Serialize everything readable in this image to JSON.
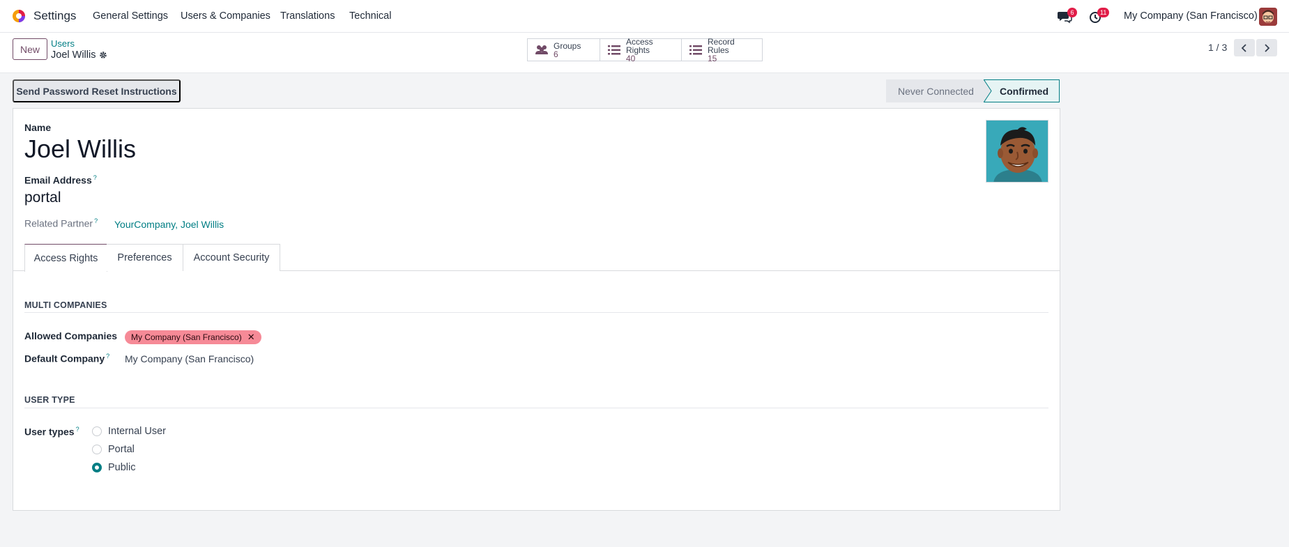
{
  "navbar": {
    "app_name": "Settings",
    "menu": [
      "General Settings",
      "Users & Companies",
      "Translations",
      "Technical"
    ],
    "messages_count": "6",
    "activities_count": "11",
    "company": "My Company (San Francisco)"
  },
  "control_panel": {
    "new_label": "New",
    "breadcrumb_parent": "Users",
    "breadcrumb_current": "Joel Willis",
    "smart_buttons": [
      {
        "label": "Groups",
        "value": "6",
        "icon": "users-icon"
      },
      {
        "label": "Access Rights",
        "value": "40",
        "icon": "list-icon"
      },
      {
        "label": "Record Rules",
        "value": "15",
        "icon": "list-icon"
      }
    ],
    "pager": "1 / 3"
  },
  "actions": {
    "reset_label": "Send Password Reset Instructions"
  },
  "statusbar": {
    "stages": [
      "Never Connected",
      "Confirmed"
    ],
    "active": "Confirmed"
  },
  "form": {
    "name_label": "Name",
    "name_value": "Joel Willis",
    "email_label": "Email Address",
    "email_value": "portal",
    "related_label": "Related Partner",
    "related_value": "YourCompany, Joel Willis",
    "help_mark": "?",
    "tabs": [
      "Access Rights",
      "Preferences",
      "Account Security"
    ],
    "active_tab": "Access Rights",
    "multi_companies": {
      "title": "MULTI COMPANIES",
      "allowed_label": "Allowed Companies",
      "allowed_tag": "My Company (San Francisco)",
      "default_label": "Default Company",
      "default_value": "My Company (San Francisco)"
    },
    "user_type": {
      "title": "USER TYPE",
      "label": "User types",
      "options": [
        "Internal User",
        "Portal",
        "Public"
      ],
      "selected": "Public"
    }
  },
  "colors": {
    "brand": "#714B67",
    "accent": "#017e84",
    "badge": "#e11d48",
    "tag": "#f68a97"
  }
}
